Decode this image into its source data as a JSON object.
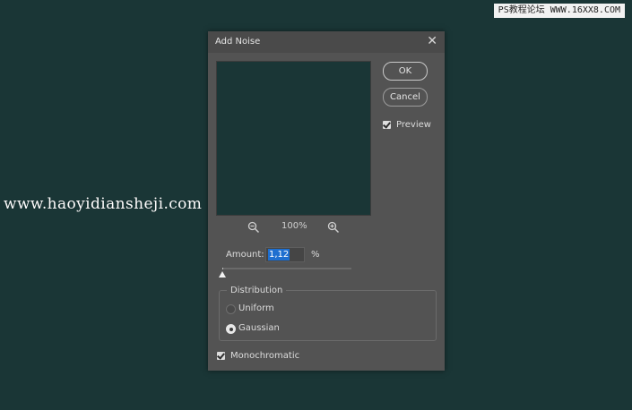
{
  "watermarks": {
    "top_right": "PS教程论坛 WWW.16XX8.COM",
    "left": "www.haoyidiansheji.com"
  },
  "dialog": {
    "title": "Add Noise",
    "close_glyph": "✕",
    "ok_label": "OK",
    "cancel_label": "Cancel",
    "preview_label": "Preview",
    "preview_checked": true,
    "zoom_out_icon": "zoom-out-icon",
    "zoom_in_icon": "zoom-in-icon",
    "zoom_level": "100%",
    "amount_label": "Amount:",
    "amount_value": "1,12",
    "amount_unit": "%",
    "distribution_label": "Distribution",
    "distribution_options": [
      "Uniform",
      "Gaussian"
    ],
    "distribution_selected": "Gaussian",
    "monochromatic_label": "Monochromatic",
    "monochromatic_checked": true,
    "colors": {
      "background": "#1a3636",
      "dialog": "#535353",
      "highlight": "#1e6fd0"
    }
  }
}
